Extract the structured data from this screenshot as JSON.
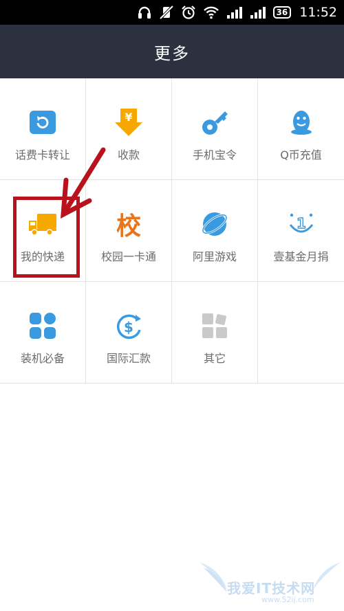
{
  "status_bar": {
    "time": "11:52",
    "network_badge": "36"
  },
  "header": {
    "title": "更多"
  },
  "grid": {
    "items": [
      {
        "label": "话费卡转让",
        "icon": "refresh-card-icon"
      },
      {
        "label": "收款",
        "icon": "yuan-download-icon"
      },
      {
        "label": "手机宝令",
        "icon": "key-icon"
      },
      {
        "label": "Q币充值",
        "icon": "qq-penguin-icon"
      },
      {
        "label": "我的快递",
        "icon": "delivery-truck-icon"
      },
      {
        "label": "校园一卡通",
        "icon": "campus-character-icon",
        "glyph": "校"
      },
      {
        "label": "阿里游戏",
        "icon": "ali-game-icon"
      },
      {
        "label": "壹基金月捐",
        "icon": "smile-one-icon",
        "glyph": "1"
      },
      {
        "label": "装机必备",
        "icon": "app-grid-icon"
      },
      {
        "label": "国际汇款",
        "icon": "dollar-swirl-icon",
        "glyph": "$"
      },
      {
        "label": "其它",
        "icon": "other-blocks-icon"
      }
    ]
  },
  "watermark": {
    "title": "我爱IT技术网",
    "url": "www.52ij.com"
  },
  "colors": {
    "status_bar": "#000000",
    "title_bar": "#2b313e",
    "blue_icon": "#3a9ae0",
    "orange_icon": "#f5a800",
    "campus_orange": "#e8741b",
    "highlight_red": "#b8121c"
  }
}
